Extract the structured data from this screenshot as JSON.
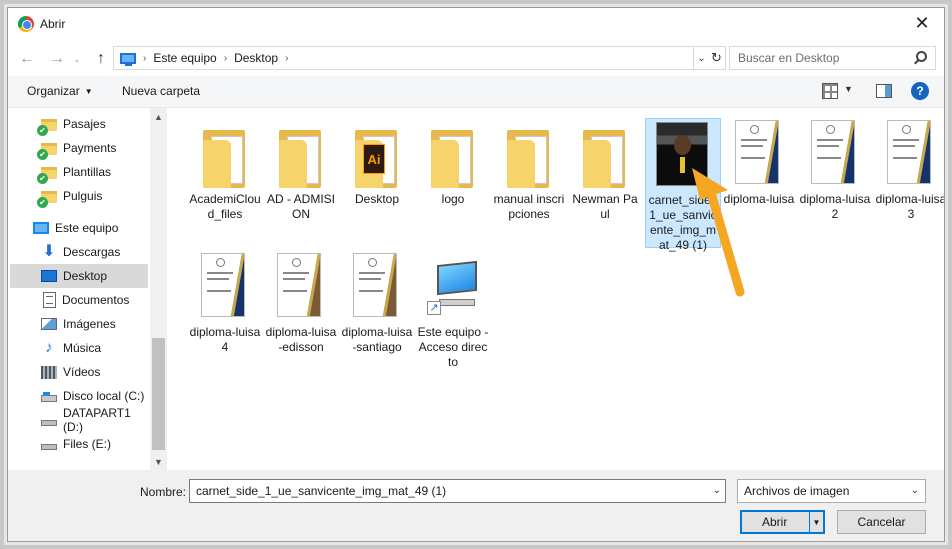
{
  "window": {
    "title": "Abrir",
    "close_glyph": "✕"
  },
  "navigation": {
    "back_glyph": "←",
    "forward_glyph": "→",
    "up_glyph": "↑",
    "breadcrumb": [
      "Este equipo",
      "Desktop"
    ],
    "crumb_separator": "›",
    "dropdown_glyph": "⌄",
    "refresh_glyph": "↻"
  },
  "search": {
    "placeholder": "Buscar en Desktop"
  },
  "toolbar": {
    "organize_label": "Organizar",
    "new_folder_label": "Nueva carpeta",
    "caret_glyph": "▼",
    "help_label": "?"
  },
  "sidebar": {
    "items": [
      {
        "label": "Pasajes",
        "icon": "folder-sync-icon"
      },
      {
        "label": "Payments",
        "icon": "folder-sync-icon"
      },
      {
        "label": "Plantillas",
        "icon": "folder-sync-icon"
      },
      {
        "label": "Pulguis",
        "icon": "folder-sync-icon"
      },
      {
        "label": "Este equipo",
        "icon": "computer-icon"
      },
      {
        "label": "Descargas",
        "icon": "download-icon"
      },
      {
        "label": "Desktop",
        "icon": "desktop-icon"
      },
      {
        "label": "Documentos",
        "icon": "documents-icon"
      },
      {
        "label": "Imágenes",
        "icon": "pictures-icon"
      },
      {
        "label": "Música",
        "icon": "music-icon"
      },
      {
        "label": "Vídeos",
        "icon": "videos-icon"
      },
      {
        "label": "Disco local (C:)",
        "icon": "local-disk-icon"
      },
      {
        "label": "DATAPART1 (D:)",
        "icon": "drive-icon"
      },
      {
        "label": "Files (E:)",
        "icon": "drive-icon"
      }
    ],
    "selected": "Desktop",
    "download_glyph": "⬇",
    "music_glyph": "♪",
    "scroll_up_glyph": "▲",
    "scroll_down_glyph": "▼"
  },
  "files": [
    {
      "label": "AcademiCloud_files",
      "kind": "folder"
    },
    {
      "label": "AD - ADMISION",
      "kind": "folder"
    },
    {
      "label": "Desktop",
      "kind": "illustrator-folder"
    },
    {
      "label": "logo",
      "kind": "folder"
    },
    {
      "label": "manual inscripciones",
      "kind": "folder"
    },
    {
      "label": "Newman Paul",
      "kind": "folder"
    },
    {
      "label": "carnet_side_1_ue_sanvicente_img_mat_49 (1)",
      "kind": "photo",
      "selected": true
    },
    {
      "label": "diploma-luisa",
      "kind": "diploma-navy"
    },
    {
      "label": "diploma-luisa2",
      "kind": "diploma-navy"
    },
    {
      "label": "diploma-luisa3",
      "kind": "diploma-navy"
    },
    {
      "label": "diploma-luisa4",
      "kind": "diploma-navy"
    },
    {
      "label": "diploma-luisa-edisson",
      "kind": "diploma-brown"
    },
    {
      "label": "diploma-luisa-santiago",
      "kind": "diploma-brown"
    },
    {
      "label": "Este equipo - Acceso directo",
      "kind": "computer-shortcut"
    }
  ],
  "ai_glyph": "Ai",
  "shortcut_glyph": "↗",
  "footer": {
    "name_label": "Nombre:",
    "name_value": "carnet_side_1_ue_sanvicente_img_mat_49 (1)",
    "filter_value": "Archivos de imagen",
    "open_label": "Abrir",
    "cancel_label": "Cancelar",
    "dropdown_glyph": "⌄",
    "split_glyph": "▼"
  },
  "colors": {
    "annotation_arrow": "#f5a623",
    "selection_bg": "#cce8ff",
    "accent": "#0078d7"
  }
}
